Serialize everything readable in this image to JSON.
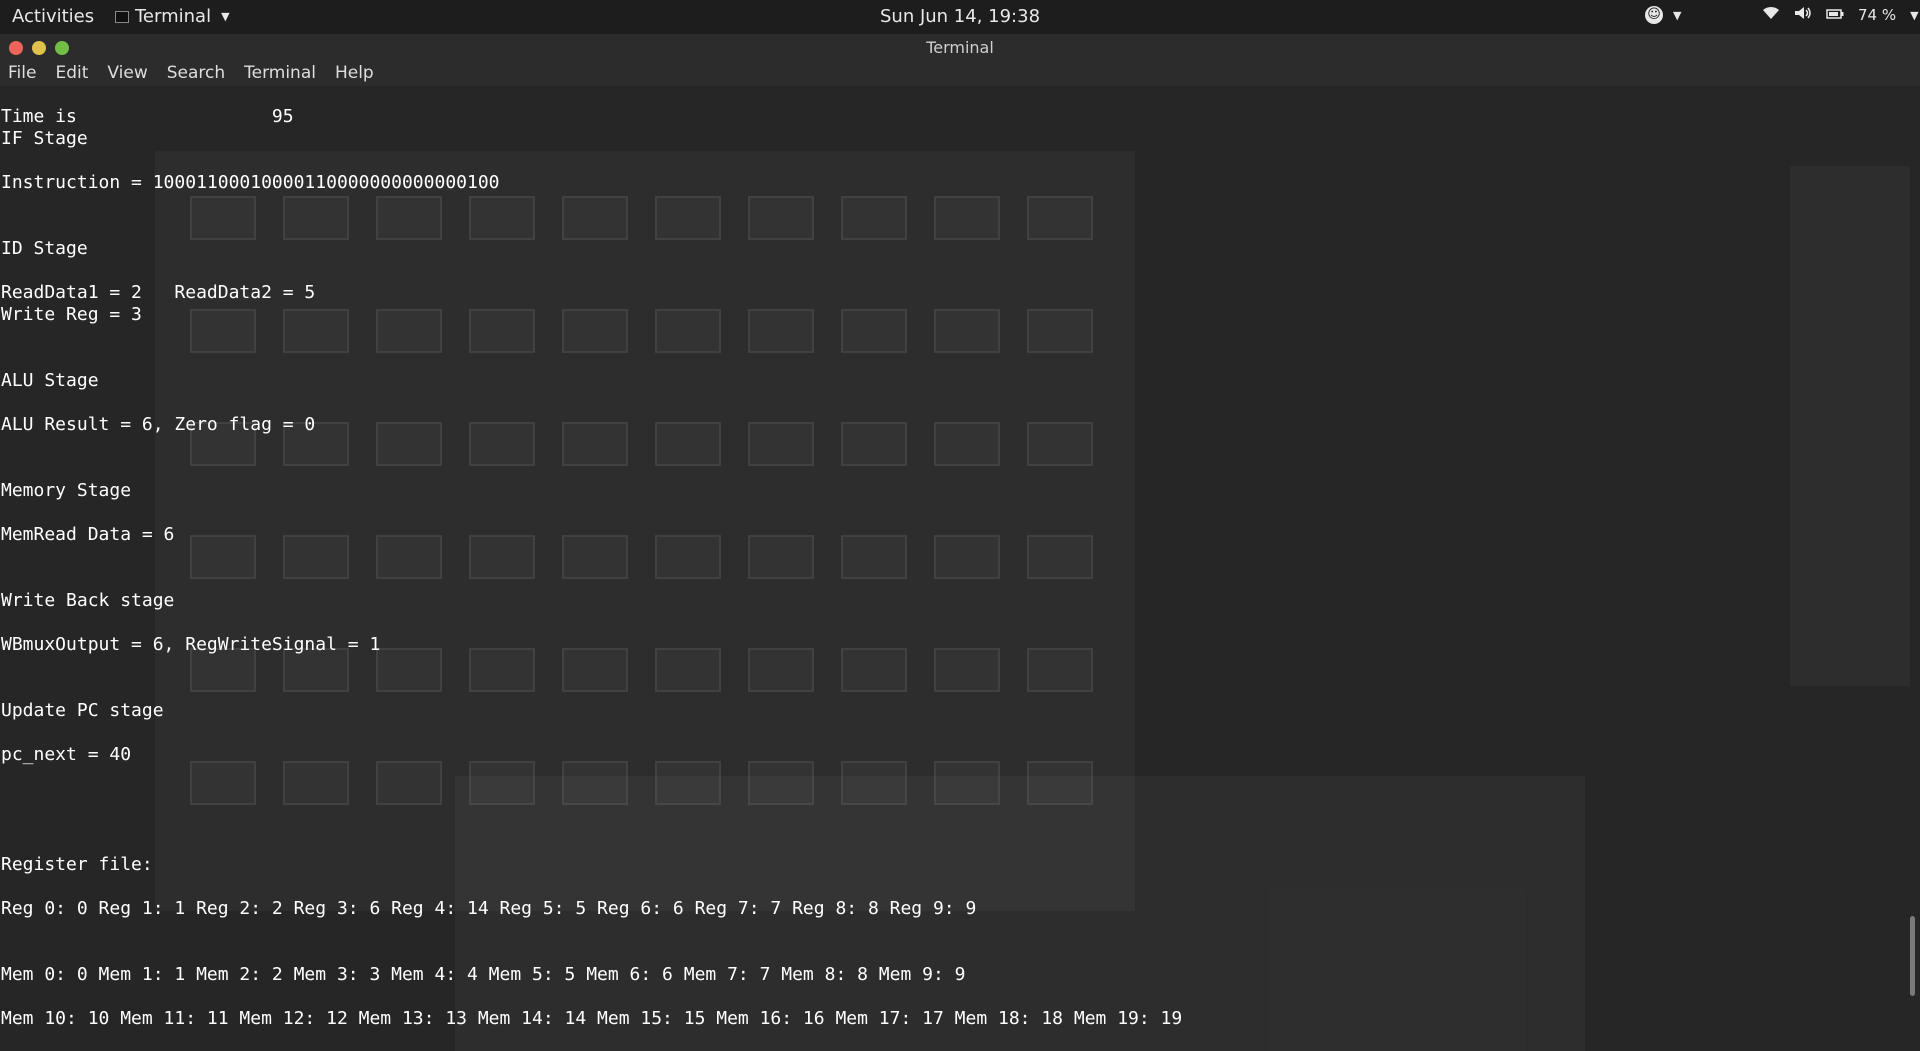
{
  "topbar": {
    "activities": "Activities",
    "app_name": "Terminal",
    "clock": "Sun Jun 14, 19:38",
    "battery": "74 %",
    "icons": [
      "accessibility-icon",
      "wifi-icon",
      "volume-icon",
      "battery-icon"
    ]
  },
  "window": {
    "title": "Terminal",
    "buttons": {
      "close": "#ed655a",
      "minimize": "#e0c14c",
      "maximize": "#72be47"
    }
  },
  "menu": [
    "File",
    "Edit",
    "View",
    "Search",
    "Terminal",
    "Help"
  ],
  "terminal": {
    "lines": [
      "Time is                  95",
      "IF Stage",
      "",
      "Instruction = 10001100010000110000000000000100",
      "",
      "",
      "ID Stage",
      "",
      "ReadData1 = 2   ReadData2 = 5",
      "Write Reg = 3",
      "",
      "",
      "ALU Stage",
      "",
      "ALU Result = 6, Zero flag = 0",
      "",
      "",
      "Memory Stage",
      "",
      "MemRead Data = 6",
      "",
      "",
      "Write Back stage",
      "",
      "WBmuxOutput = 6, RegWriteSignal = 1",
      "",
      "",
      "Update PC stage",
      "",
      "pc_next = 40",
      "",
      "",
      "",
      "",
      "Register file:",
      "",
      "Reg 0: 0 Reg 1: 1 Reg 2: 2 Reg 3: 6 Reg 4: 14 Reg 5: 5 Reg 6: 6 Reg 7: 7 Reg 8: 8 Reg 9: 9",
      "",
      "",
      "Mem 0: 0 Mem 1: 1 Mem 2: 2 Mem 3: 3 Mem 4: 4 Mem 5: 5 Mem 6: 6 Mem 7: 7 Mem 8: 8 Mem 9: 9",
      "",
      "Mem 10: 10 Mem 11: 11 Mem 12: 12 Mem 13: 13 Mem 14: 14 Mem 15: 15 Mem 16: 16 Mem 17: 17 Mem 18: 18 Mem 19: 19"
    ]
  }
}
